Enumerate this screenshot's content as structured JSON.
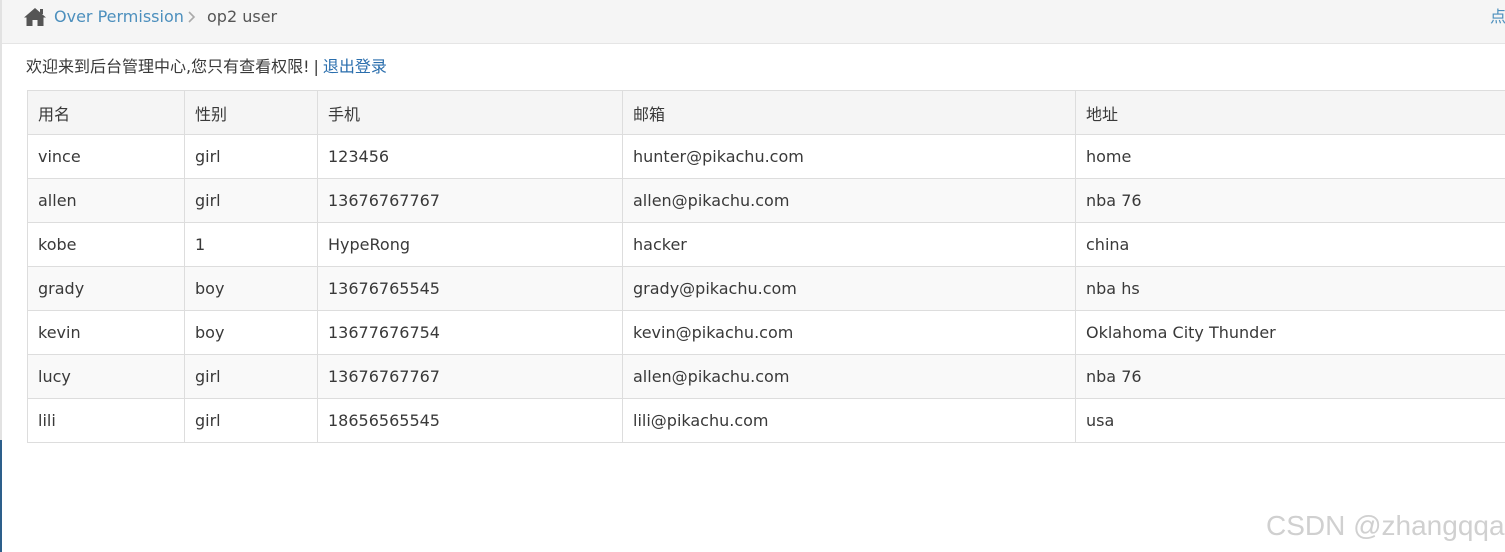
{
  "breadcrumb": {
    "link_label": "Over Permission",
    "current_label": "op2 user",
    "right_label": "点"
  },
  "welcome": {
    "message": "欢迎来到后台管理中心,您只有查看权限!",
    "separator": "|",
    "logout_label": "退出登录"
  },
  "table": {
    "headers": [
      "用名",
      "性别",
      "手机",
      "邮箱",
      "地址"
    ],
    "rows": [
      [
        "vince",
        "girl",
        "123456",
        "hunter@pikachu.com",
        "home"
      ],
      [
        "allen",
        "girl",
        "13676767767",
        "allen@pikachu.com",
        "nba 76"
      ],
      [
        "kobe",
        "1",
        "HypeRong",
        "hacker",
        "china"
      ],
      [
        "grady",
        "boy",
        "13676765545",
        "grady@pikachu.com",
        "nba hs"
      ],
      [
        "kevin",
        "boy",
        "13677676754",
        "kevin@pikachu.com",
        "Oklahoma City Thunder"
      ],
      [
        "lucy",
        "girl",
        "13676767767",
        "allen@pikachu.com",
        "nba 76"
      ],
      [
        "lili",
        "girl",
        "18656565545",
        "lili@pikachu.com",
        "usa"
      ]
    ]
  },
  "watermark": "CSDN @zhangqqa",
  "colors": {
    "link": "#4c8fbd",
    "logout": "#2a6ead",
    "breadcrumb_bg": "#f5f5f5",
    "accent_edge": "#2d5f8b"
  },
  "icons": {
    "home": "home-icon",
    "separator": "chevron-right-icon"
  }
}
